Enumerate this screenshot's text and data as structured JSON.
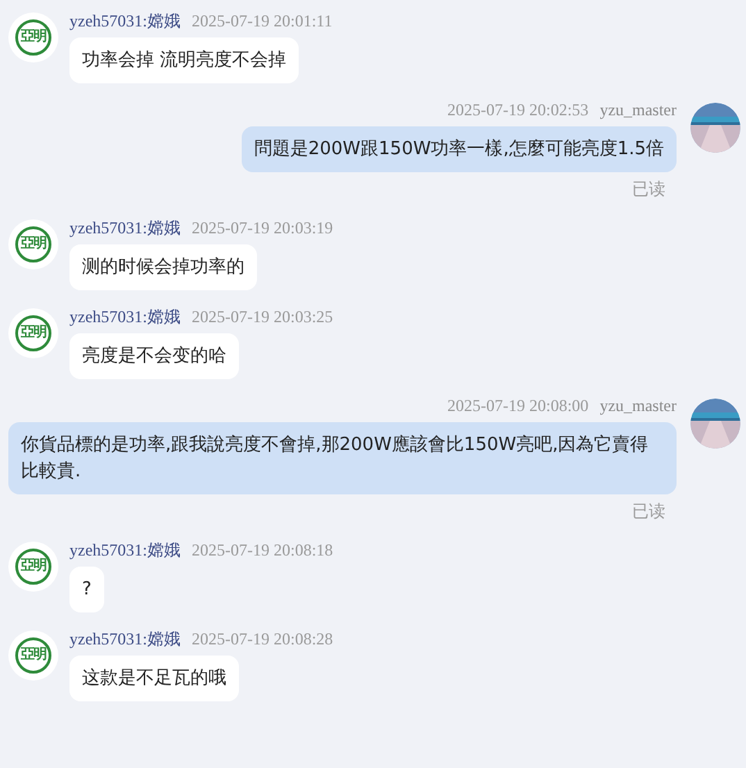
{
  "messages": [
    {
      "kind": "received",
      "sender": "yzeh57031:嫦娥",
      "time": "2025-07-19 20:01:11",
      "text": "功率会掉 流明亮度不会掉",
      "logo_text": "亞明"
    },
    {
      "kind": "sent",
      "sender": "yzu_master",
      "time": "2025-07-19 20:02:53",
      "text": "問題是200W跟150W功率一樣,怎麼可能亮度1.5倍",
      "read_receipt": "已读"
    },
    {
      "kind": "received",
      "sender": "yzeh57031:嫦娥",
      "time": "2025-07-19 20:03:19",
      "text": "测的时候会掉功率的",
      "logo_text": "亞明"
    },
    {
      "kind": "received",
      "sender": "yzeh57031:嫦娥",
      "time": "2025-07-19 20:03:25",
      "text": "亮度是不会变的哈",
      "logo_text": "亞明"
    },
    {
      "kind": "sent",
      "sender": "yzu_master",
      "time": "2025-07-19 20:08:00",
      "text": "你貨品標的是功率,跟我說亮度不會掉,那200W應該會比150W亮吧,因為它賣得比較貴.",
      "read_receipt": "已读"
    },
    {
      "kind": "received",
      "sender": "yzeh57031:嫦娥",
      "time": "2025-07-19 20:08:18",
      "text": "?",
      "logo_text": "亞明"
    },
    {
      "kind": "received",
      "sender": "yzeh57031:嫦娥",
      "time": "2025-07-19 20:08:28",
      "text": "这款是不足瓦的哦",
      "logo_text": "亞明"
    }
  ]
}
